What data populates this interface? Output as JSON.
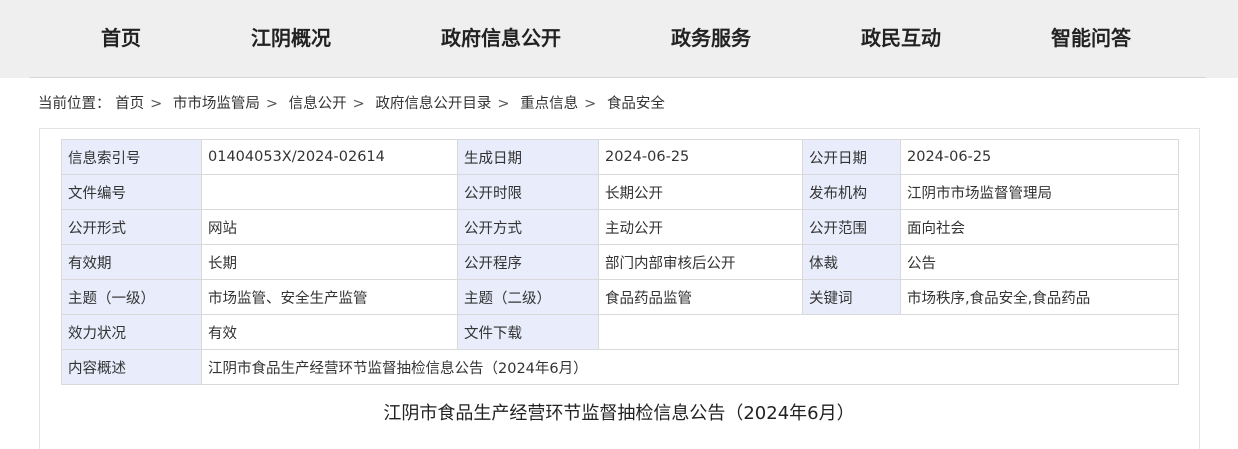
{
  "nav": {
    "items": [
      "首页",
      "江阴概况",
      "政府信息公开",
      "政务服务",
      "政民互动",
      "智能问答"
    ]
  },
  "breadcrumb": {
    "prefix": "当前位置：",
    "items": [
      "首页",
      "市市场监管局",
      "信息公开",
      "政府信息公开目录",
      "重点信息",
      "食品安全"
    ],
    "separator": ">"
  },
  "meta": {
    "rows": [
      [
        "信息索引号",
        "01404053X/2024-02614",
        "生成日期",
        "2024-06-25",
        "公开日期",
        "2024-06-25"
      ],
      [
        "文件编号",
        "",
        "公开时限",
        "长期公开",
        "发布机构",
        "江阴市市场监督管理局"
      ],
      [
        "公开形式",
        "网站",
        "公开方式",
        "主动公开",
        "公开范围",
        "面向社会"
      ],
      [
        "有效期",
        "长期",
        "公开程序",
        "部门内部审核后公开",
        "体裁",
        "公告"
      ],
      [
        "主题（一级）",
        "市场监管、安全生产监管",
        "主题（二级）",
        "食品药品监管",
        "关键词",
        "市场秩序,食品安全,食品药品"
      ],
      [
        "效力状况",
        "有效",
        "文件下载",
        ""
      ],
      [
        "内容概述",
        "江阴市食品生产经营环节监督抽检信息公告（2024年6月）"
      ]
    ]
  },
  "document": {
    "title": "江阴市食品生产经营环节监督抽检信息公告（2024年6月）"
  },
  "colors": {
    "nav_bg": "#efefef",
    "label_bg": "#e8ecfb",
    "border": "#d9d9d9"
  }
}
